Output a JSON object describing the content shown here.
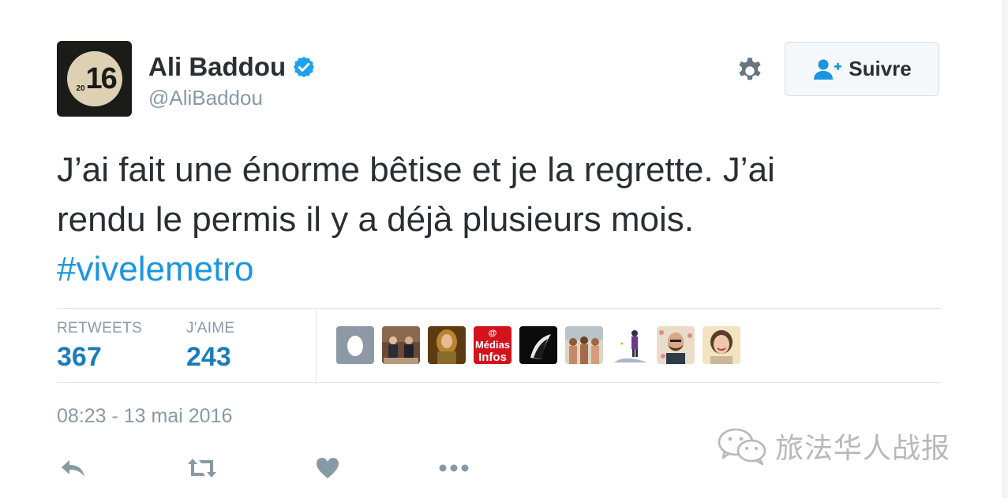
{
  "profile": {
    "avatar_text_small": "20",
    "avatar_text_big": "16",
    "display_name": "Ali Baddou",
    "handle": "@AliBaddou",
    "verified": true
  },
  "header": {
    "settings_icon": "gear-icon",
    "follow_label": "Suivre",
    "follow_icon": "add-user-icon"
  },
  "tweet": {
    "line1": "J’ai fait une énorme bêtise et je la regrette. J’ai",
    "line2": "rendu le permis il y a déjà plusieurs mois.",
    "hashtag": "#vivelemetro"
  },
  "stats": {
    "retweets_label": "RETWEETS",
    "retweets_value": "367",
    "likes_label": "J'AIME",
    "likes_value": "243"
  },
  "likers": [
    {
      "name": "default-egg-avatar"
    },
    {
      "name": "group-photo-avatar"
    },
    {
      "name": "portrait-avatar"
    },
    {
      "name": "medias-infos-avatar",
      "text_top": "@",
      "text_mid": "Médias",
      "text_bottom": "Infos"
    },
    {
      "name": "dark-profile-avatar"
    },
    {
      "name": "beach-group-avatar"
    },
    {
      "name": "figure-illustration-avatar"
    },
    {
      "name": "man-beard-avatar"
    },
    {
      "name": "woman-smiling-avatar"
    }
  ],
  "timestamp": "08:23 - 13 mai 2016",
  "actions": {
    "reply_icon": "reply-icon",
    "retweet_icon": "retweet-icon",
    "like_icon": "heart-icon",
    "more_icon": "more-icon"
  },
  "watermark": {
    "text": "旅法华人战报",
    "icon": "wechat-icon"
  },
  "colors": {
    "text": "#292f33",
    "muted": "#8899a6",
    "link": "#1b95e0",
    "stat": "#1b7cb8",
    "verified": "#1da1f2",
    "media_red": "#d3121c"
  }
}
